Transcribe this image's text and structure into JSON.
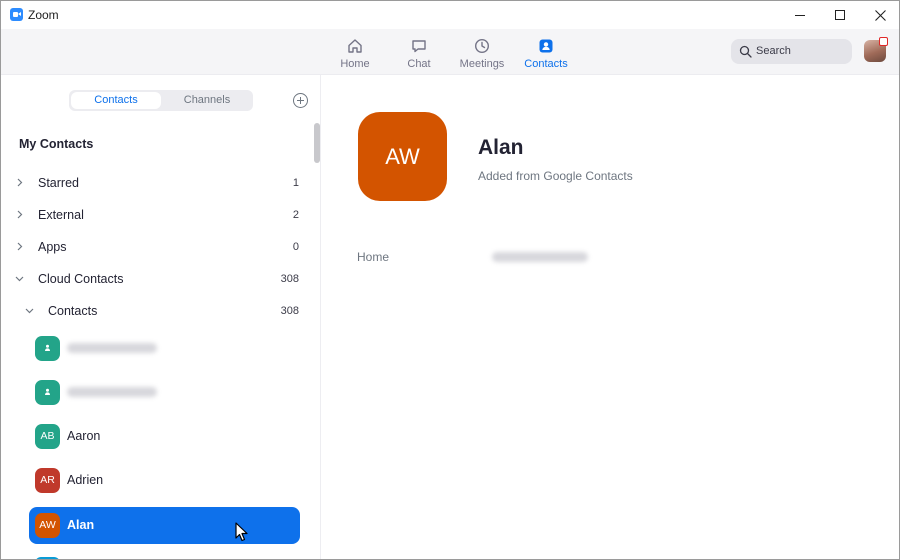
{
  "window": {
    "title": "Zoom"
  },
  "nav": {
    "items": [
      {
        "label": "Home",
        "icon": "home-icon"
      },
      {
        "label": "Chat",
        "icon": "chat-icon"
      },
      {
        "label": "Meetings",
        "icon": "clock-icon"
      },
      {
        "label": "Contacts",
        "icon": "contacts-icon",
        "active": true
      }
    ],
    "search_label": "Search",
    "accent_color": "#0e71eb"
  },
  "sidebar": {
    "tabs": [
      {
        "label": "Contacts",
        "active": true
      },
      {
        "label": "Channels",
        "active": false
      }
    ],
    "section_title": "My Contacts",
    "groups": [
      {
        "label": "Starred",
        "count": "1",
        "expanded": false
      },
      {
        "label": "External",
        "count": "2",
        "expanded": false
      },
      {
        "label": "Apps",
        "count": "0",
        "expanded": false
      },
      {
        "label": "Cloud Contacts",
        "count": "308",
        "expanded": true
      },
      {
        "label": "Contacts",
        "count": "308",
        "expanded": true
      }
    ],
    "contacts": [
      {
        "initials": "",
        "name": "",
        "color": "#23a489",
        "blurred": true
      },
      {
        "initials": "",
        "name": "",
        "color": "#23a489",
        "blurred": true
      },
      {
        "initials": "AB",
        "name": "Aaron",
        "color": "#23a489"
      },
      {
        "initials": "AR",
        "name": "Adrien",
        "color": "#c0392b"
      },
      {
        "initials": "AW",
        "name": "Alan",
        "color": "#d35400",
        "selected": true
      }
    ]
  },
  "detail": {
    "initials": "AW",
    "name": "Alan",
    "source": "Added from Google Contacts",
    "avatar_color": "#d35400",
    "fields": [
      {
        "label": "Home",
        "value_hidden": true
      }
    ]
  }
}
